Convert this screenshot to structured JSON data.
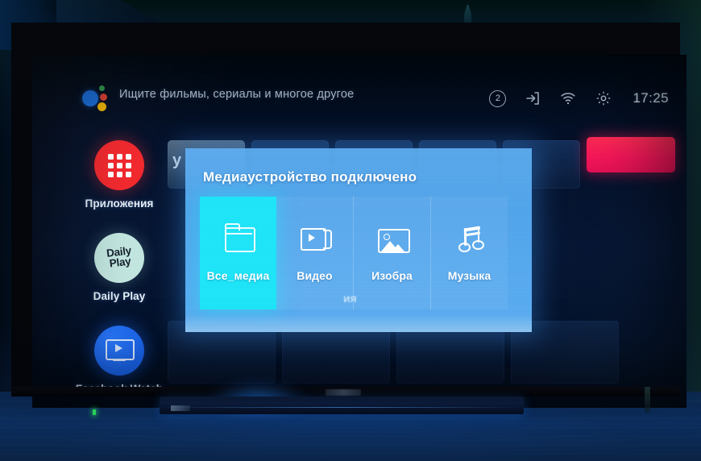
{
  "device": {
    "kind": "android-tv",
    "led_color": "#2ad05a"
  },
  "topbar": {
    "assistant_icon": "google-assistant-icon",
    "search_hint": "Ищите фильмы, сериалы и многое другое",
    "notification_count": "2",
    "input_icon": "input-source-icon",
    "wifi_icon": "wifi-icon",
    "settings_icon": "gear-icon",
    "clock": "17:25"
  },
  "rail": {
    "items": [
      {
        "label": "Приложения",
        "icon": "apps-grid-icon",
        "color": "#f2282d"
      },
      {
        "label": "Daily Play",
        "icon": "daily-play-logo",
        "color": "#c3e6e0",
        "logo_line1": "Daily",
        "logo_line2": "Play"
      },
      {
        "label": "Facebook Watch",
        "icon": "facebook-watch-icon",
        "color": "#1862e8"
      }
    ]
  },
  "background_row": {
    "left_fragment": "y",
    "add_button_icon": "plus-icon",
    "highlight_color": "#f5165a"
  },
  "overlay": {
    "title": "Медиаустройство подключено",
    "accent_selected": "#1fe4f7",
    "panel_color": "#5cb0f4",
    "ghost_text": "ия",
    "tiles": [
      {
        "label": "Все_медиа",
        "icon": "folder-icon",
        "selected": true
      },
      {
        "label": "Видео",
        "icon": "video-icon",
        "selected": false
      },
      {
        "label": "Изобра",
        "icon": "image-icon",
        "selected": false
      },
      {
        "label": "Музыка",
        "icon": "music-icon",
        "selected": false
      }
    ]
  }
}
